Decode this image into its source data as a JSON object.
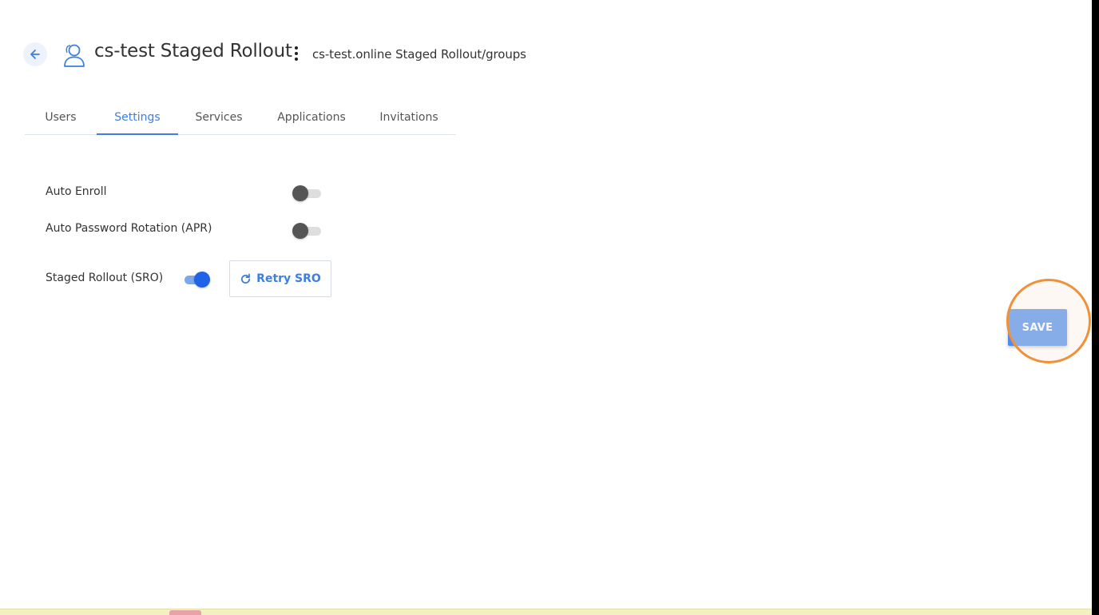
{
  "header": {
    "title": "cs-test Staged Rollout",
    "breadcrumb": "cs-test.online Staged Rollout/groups"
  },
  "tabs": [
    {
      "label": "Users",
      "active": false
    },
    {
      "label": "Settings",
      "active": true
    },
    {
      "label": "Services",
      "active": false
    },
    {
      "label": "Applications",
      "active": false
    },
    {
      "label": "Invitations",
      "active": false
    }
  ],
  "settings": [
    {
      "label": "Auto Enroll",
      "enabled": false
    },
    {
      "label": "Auto Password Rotation (APR)",
      "enabled": false
    },
    {
      "label": "Staged Rollout (SRO)",
      "enabled": true
    }
  ],
  "actions": {
    "retry_label": "Retry SRO",
    "save_label": "SAVE"
  },
  "colors": {
    "accent": "#3d7fe0",
    "toggle_on": "#1f63e6",
    "save_button": "#4a8cf0",
    "highlight": "#f0913a"
  }
}
